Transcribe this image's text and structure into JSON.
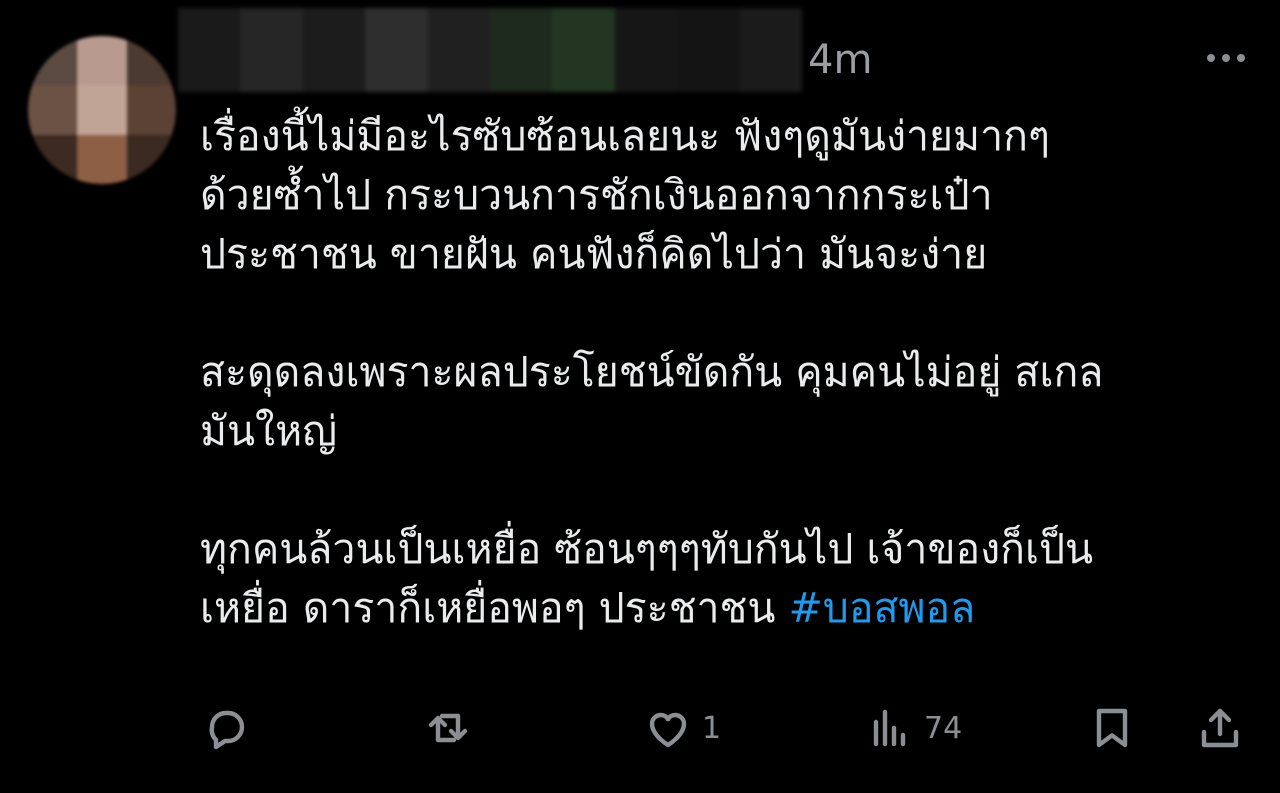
{
  "tweet": {
    "time": "4m",
    "paragraphs": [
      "เรื่องนี้ไม่มีอะไรซับซ้อนเลยนะ ฟังๆดูมันง่ายมากๆ\nด้วยซ้ำไป กระบวนการชักเงินออกจากกระเป๋า\nประชาชน ขายฝัน คนฟังก็คิดไปว่า มันจะง่าย",
      "สะดุดลงเพราะผลประโยชน์ขัดกัน คุมคนไม่อยู่ สเกล\nมันใหญ่"
    ],
    "last_paragraph_text": "ทุกคนล้วนเป็นเหยื่อ ซ้อนๆๆๆทับกันไป เจ้าของก็เป็น\nเหยื่อ ดาราก็เหยื่อพอๆ ประชาชน ",
    "hashtag": "#บอสพอล",
    "hashtag_color": "#1d9bf0"
  },
  "actions": {
    "reply": {
      "icon": "reply-icon",
      "count": ""
    },
    "retweet": {
      "icon": "retweet-icon",
      "count": ""
    },
    "like": {
      "icon": "heart-icon",
      "count": "1"
    },
    "views": {
      "icon": "views-icon",
      "count": "74"
    },
    "bookmark": {
      "icon": "bookmark-icon",
      "count": ""
    },
    "share": {
      "icon": "share-icon",
      "count": ""
    }
  },
  "colors": {
    "background": "#000000",
    "text": "#e9ebec",
    "muted": "#8b8f94",
    "accent": "#1d9bf0"
  }
}
